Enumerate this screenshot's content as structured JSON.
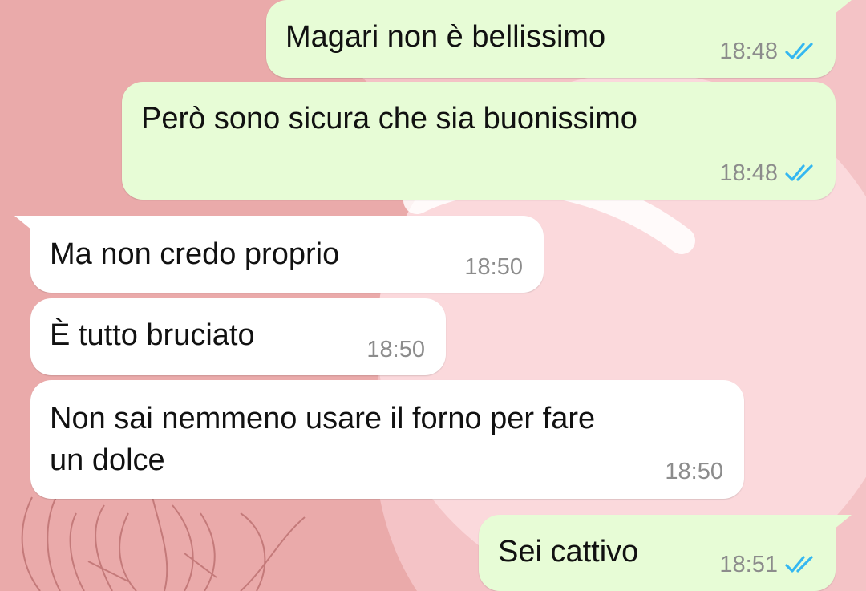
{
  "colors": {
    "outgoing_bubble": "#e7fcd6",
    "incoming_bubble": "#ffffff",
    "wallpaper_pink": "#eaaaaa",
    "wallpaper_light": "#fbd9dc",
    "read_ticks": "#34b7f1",
    "timestamp": "#8c8c8c"
  },
  "messages": [
    {
      "direction": "outgoing",
      "text": "Magari non è bellissimo",
      "time": "18:48",
      "status": "read",
      "icon": "double-check-icon"
    },
    {
      "direction": "outgoing",
      "text": "Però sono sicura che sia buonissimo",
      "time": "18:48",
      "status": "read",
      "icon": "double-check-icon"
    },
    {
      "direction": "incoming",
      "text": "Ma non credo proprio",
      "time": "18:50"
    },
    {
      "direction": "incoming",
      "text": "È tutto bruciato",
      "time": "18:50"
    },
    {
      "direction": "incoming",
      "lines": [
        "Non sai nemmeno usare il forno per fare",
        "un dolce"
      ],
      "time": "18:50"
    },
    {
      "direction": "outgoing",
      "text": "Sei cattivo",
      "time": "18:51",
      "status": "read",
      "icon": "double-check-icon"
    }
  ]
}
